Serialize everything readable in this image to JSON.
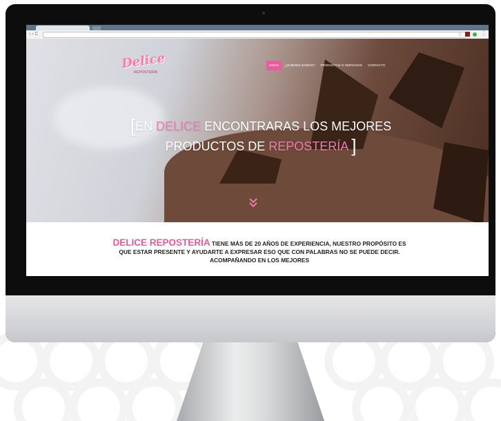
{
  "browser": {
    "tab_close": "×",
    "nav_arrows": "‹ › C",
    "star_icon": "☆",
    "menu_dots": "⋮"
  },
  "site": {
    "logo_script": "Delice",
    "logo_sub": "REPOSTERÍA",
    "nav": [
      "INICIO",
      "¿QUIENES SOMOS?",
      "PRODUCTOS O SERVICIOS",
      "CONTACTO"
    ],
    "hero": {
      "bracket_open": "[",
      "line1_a": "EN ",
      "line1_brand": "DELICE",
      "line1_b": " ENCONTRARAS LOS MEJORES",
      "line2_a": "PRODUCTOS DE ",
      "line2_brand": "REPOSTERÍA",
      "bracket_close": "]"
    },
    "about": {
      "brand": "DELICE REPOSTERÍA",
      "text": " TIENE MÁS DE 20 AÑOS DE EXPERIENCIA, NUESTRO PROPÓSITO ES QUE ESTAR PRESENTE Y AYUDARTE A EXPRESAR ESO QUE CON PALABRAS NO SE PUEDE DECIR. ACOMPAÑANDO EN LOS MEJORES"
    }
  },
  "colors": {
    "accent_pink": "#ea5b9c",
    "brand_pink": "#e25a98"
  }
}
